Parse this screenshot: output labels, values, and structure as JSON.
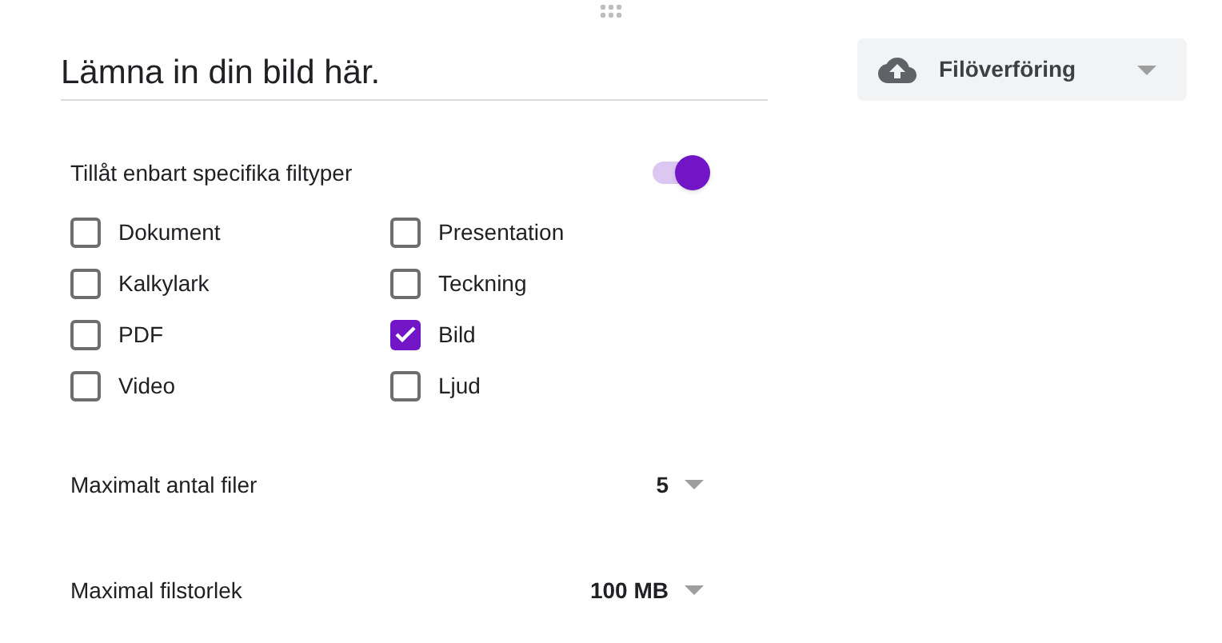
{
  "title_field": {
    "value": "Lämna in din bild här."
  },
  "question_type": {
    "label": "Filöverföring"
  },
  "restrict_types": {
    "label": "Tillåt enbart specifika filtyper",
    "on": true
  },
  "file_types": [
    {
      "label": "Dokument",
      "checked": false
    },
    {
      "label": "Presentation",
      "checked": false
    },
    {
      "label": "Kalkylark",
      "checked": false
    },
    {
      "label": "Teckning",
      "checked": false
    },
    {
      "label": "PDF",
      "checked": false
    },
    {
      "label": "Bild",
      "checked": true
    },
    {
      "label": "Video",
      "checked": false
    },
    {
      "label": "Ljud",
      "checked": false
    }
  ],
  "settings": [
    {
      "label": "Maximalt antal filer",
      "value": "5"
    },
    {
      "label": "Maximal filstorlek",
      "value": "100 MB"
    }
  ]
}
